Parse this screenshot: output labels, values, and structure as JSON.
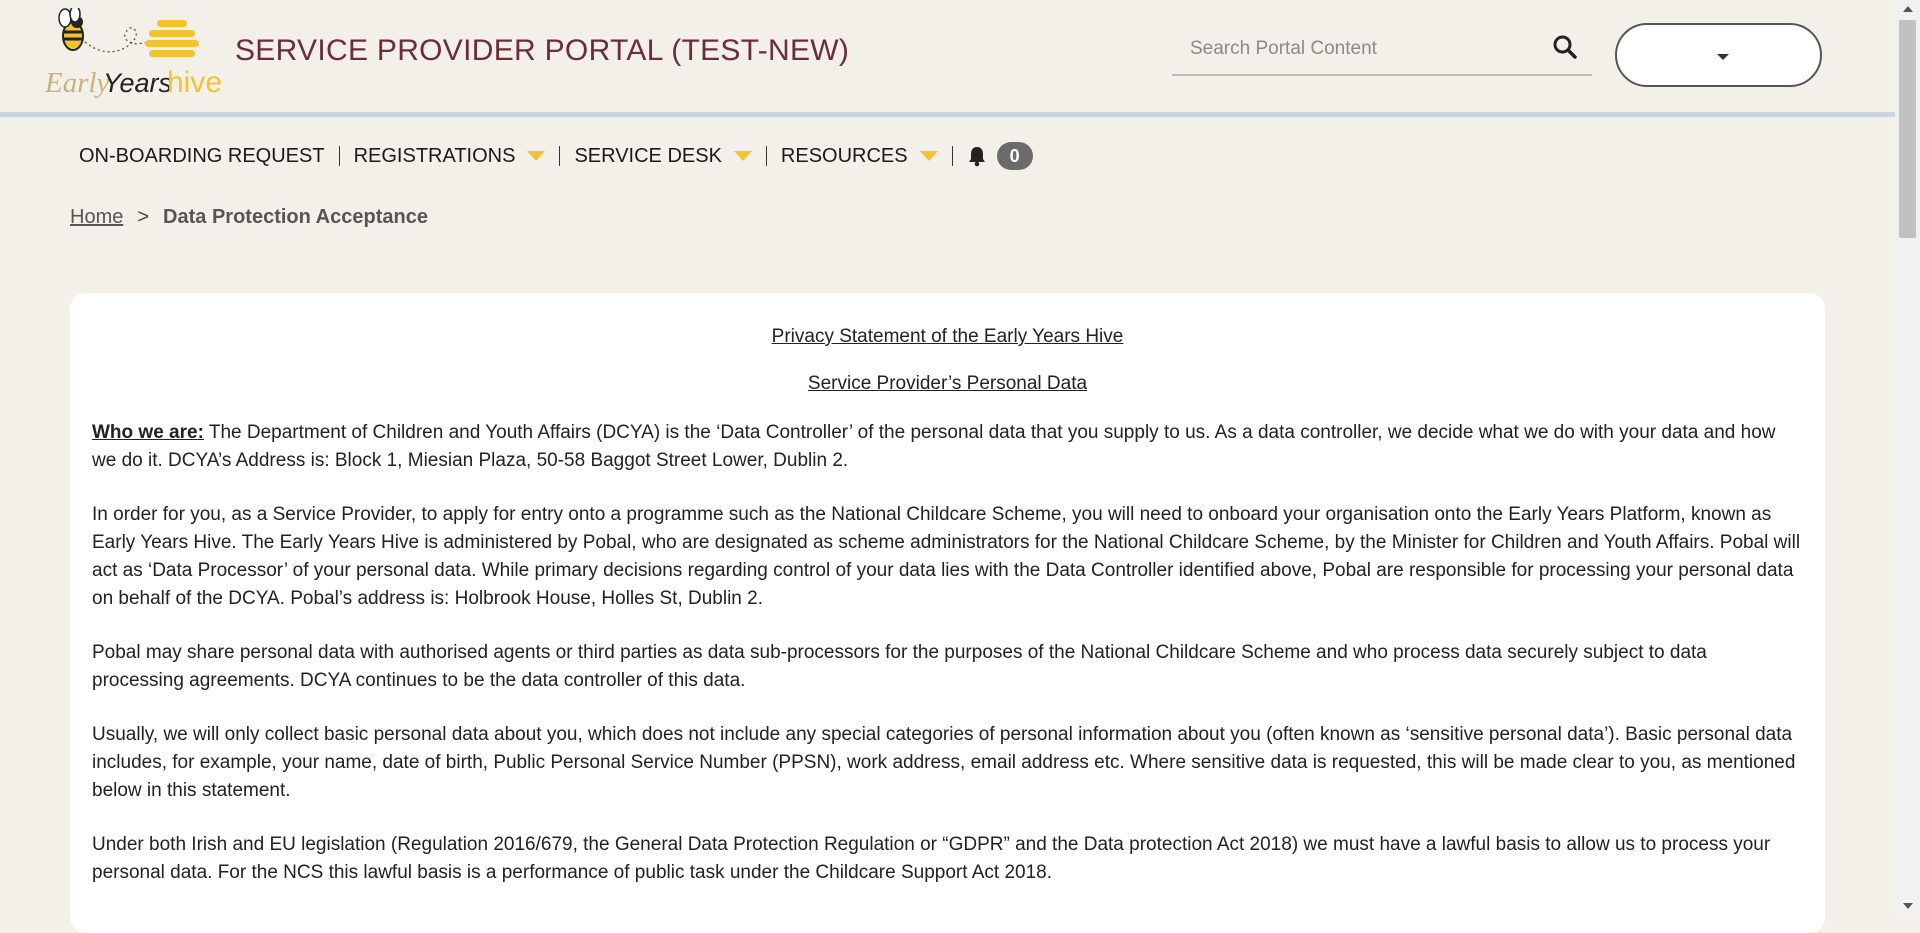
{
  "header": {
    "logo_text_early": "Early",
    "logo_text_years": "Years",
    "logo_text_hive": "hive",
    "portal_title": "SERVICE PROVIDER PORTAL (TEST-NEW)",
    "search_placeholder": "Search Portal Content",
    "search_icon": "search-icon",
    "user_menu_icon": "caret-down-icon"
  },
  "nav": {
    "items": [
      {
        "label": "ON-BOARDING REQUEST",
        "dropdown": false
      },
      {
        "label": "REGISTRATIONS",
        "dropdown": true
      },
      {
        "label": "SERVICE DESK",
        "dropdown": true
      },
      {
        "label": "RESOURCES",
        "dropdown": true
      }
    ],
    "notification_icon": "bell-icon",
    "notification_count": "0"
  },
  "breadcrumb": {
    "home": "Home",
    "separator": ">",
    "current": "Data Protection Acceptance"
  },
  "content": {
    "title": "Privacy Statement of the Early Years Hive",
    "subtitle": "Service Provider’s Personal Data",
    "who_label": "Who we are:",
    "who_text": " The Department of Children and Youth Affairs (DCYA) is the ‘Data Controller’ of the personal data that you supply to us. As a data controller, we decide what we do with your data and how we do it. DCYA’s Address is: Block 1, Miesian Plaza, 50-58 Baggot Street Lower, Dublin 2.",
    "paragraphs": [
      "In order for you, as a Service Provider, to apply for entry onto a programme such as the National Childcare Scheme, you will need to onboard your organisation onto the Early Years Platform, known as Early Years Hive. The Early Years Hive is administered by Pobal, who are designated as scheme administrators for the National Childcare Scheme, by the Minister for Children and Youth Affairs. Pobal will act as ‘Data Processor’ of your personal data. While primary decisions regarding control of your data lies with the Data Controller identified above, Pobal are responsible for processing your personal data on behalf of the DCYA. Pobal’s address is: Holbrook House, Holles St, Dublin 2.",
      "Pobal may share personal data with authorised agents or third parties as data sub-processors for the purposes of the National Childcare Scheme and who process data securely subject to data processing agreements. DCYA continues to be the data controller of this data.",
      "Usually, we will only collect basic personal data about you, which does not include any special categories of personal information about you (often known as ‘sensitive personal data’). Basic personal data includes, for example, your name, date of birth, Public Personal Service Number (PPSN), work address, email address etc. Where sensitive data is requested, this will be made clear to you, as mentioned below in this statement.",
      "Under both Irish and EU legislation (Regulation 2016/679, the General Data Protection Regulation or “GDPR” and the Data protection Act 2018) we must have a lawful basis to allow us to process your personal data. For the NCS this lawful basis is a performance of public task under the Childcare Support Act 2018."
    ]
  },
  "colors": {
    "background": "#f3f0e9",
    "title": "#6b2d3a",
    "accent_yellow": "#f2c230",
    "badge": "#6b6b6b",
    "header_line": "#c9d6df"
  }
}
